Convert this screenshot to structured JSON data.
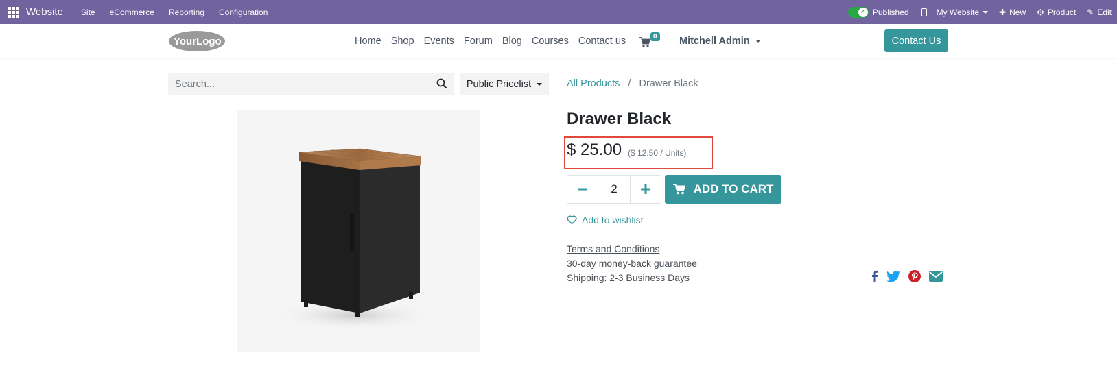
{
  "adminbar": {
    "brand": "Website",
    "menus": [
      "Site",
      "eCommerce",
      "Reporting",
      "Configuration"
    ],
    "published_label": "Published",
    "my_website_label": "My Website",
    "new_label": "New",
    "product_label": "Product",
    "edit_label": "Edit"
  },
  "sitenav": {
    "logo_text": "YourLogo",
    "links": [
      "Home",
      "Shop",
      "Events",
      "Forum",
      "Blog",
      "Courses",
      "Contact us"
    ],
    "cart_count": "0",
    "user_name": "Mitchell Admin",
    "contact_button": "Contact Us"
  },
  "search": {
    "placeholder": "Search...",
    "pricelist_label": "Public Pricelist"
  },
  "breadcrumb": {
    "parent": "All Products",
    "separator": "/",
    "current": "Drawer Black"
  },
  "product": {
    "name": "Drawer Black",
    "price": "$ 25.00",
    "unit_price": "($ 12.50 / Units)",
    "quantity": "2",
    "add_to_cart": "ADD TO CART",
    "wishlist": "Add to wishlist",
    "terms": "Terms and Conditions",
    "guarantee": "30-day money-back guarantee",
    "shipping": "Shipping: 2-3 Business Days"
  },
  "colors": {
    "admin_bar": "#71639e",
    "accent": "#35979c",
    "highlight_box": "#e04a3c",
    "facebook": "#3b5998",
    "twitter": "#1da1f2",
    "pinterest": "#cb2027",
    "email": "#35979c"
  },
  "icons": [
    "apps-grid-icon",
    "check-icon",
    "mobile-icon",
    "plus-icon",
    "gear-icon",
    "pencil-icon",
    "cart-icon",
    "search-icon",
    "minus-icon",
    "plus-icon",
    "heart-icon",
    "facebook-icon",
    "twitter-icon",
    "pinterest-icon",
    "envelope-icon"
  ]
}
